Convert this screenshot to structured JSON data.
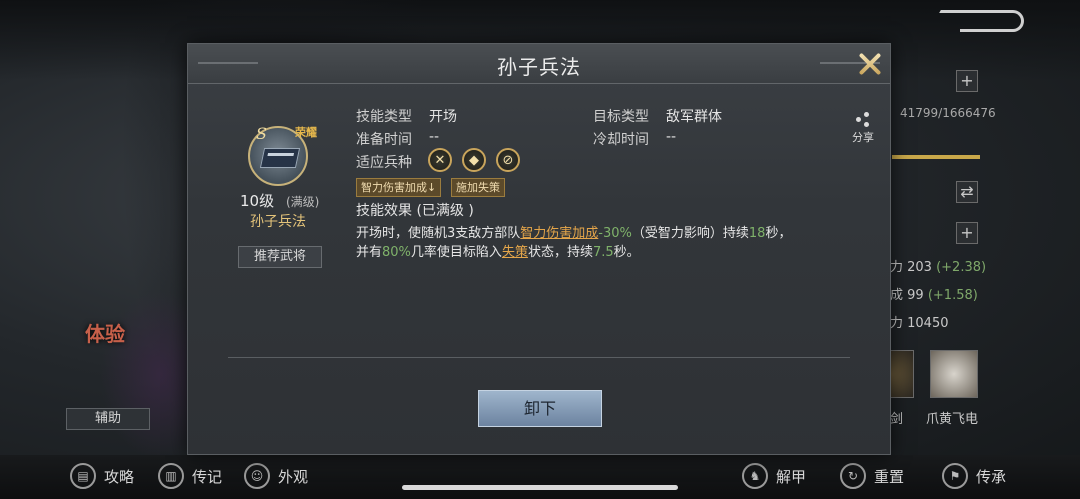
{
  "background": {
    "experience_label": "体验",
    "assist_label": "辅助",
    "progress_text": "41799/1666476",
    "stats": [
      {
        "label": "力 203",
        "delta": "(+2.38)"
      },
      {
        "label": "成 99",
        "delta": "(+1.58)"
      },
      {
        "label": "力 10450",
        "delta": ""
      }
    ],
    "side_cards": [
      {
        "label": "剑"
      },
      {
        "label": "爪黄飞电"
      }
    ]
  },
  "bottom_nav": {
    "items": [
      {
        "label": "攻略",
        "icon": "guide-icon"
      },
      {
        "label": "传记",
        "icon": "biography-icon"
      },
      {
        "label": "外观",
        "icon": "appearance-icon"
      },
      {
        "label": "解甲",
        "icon": "unarmor-icon"
      },
      {
        "label": "重置",
        "icon": "reset-icon"
      },
      {
        "label": "传承",
        "icon": "inherit-icon"
      }
    ]
  },
  "modal": {
    "title": "孙子兵法",
    "skill": {
      "grade": "S",
      "honor_tag": "荣耀",
      "level": "10级",
      "level_note": "(满级)",
      "name": "孙子兵法",
      "recommend_label": "推荐武将"
    },
    "info": {
      "skill_type_label": "技能类型",
      "skill_type_value": "开场",
      "target_type_label": "目标类型",
      "target_type_value": "敌军群体",
      "prep_time_label": "准备时间",
      "prep_time_value": "--",
      "cooldown_label": "冷却时间",
      "cooldown_value": "--",
      "troop_label": "适应兵种"
    },
    "tags": [
      "智力伤害加成↓",
      "施加失策"
    ],
    "effect_title": "技能效果 (已满级 )",
    "description": {
      "p1": "开场时，使随机3支敌方部队",
      "hl1": "智力伤害加成",
      "n1": "-30%",
      "p2": "（受智力影响）持续",
      "n2": "18",
      "p3": "秒，",
      "p4": "并有",
      "n3": "80%",
      "p5": "几率使目标陷入",
      "hl2": "失策",
      "p6": "状态，持续",
      "n4": "7.5",
      "p7": "秒。"
    },
    "share_label": "分享",
    "unload_label": "卸下"
  }
}
